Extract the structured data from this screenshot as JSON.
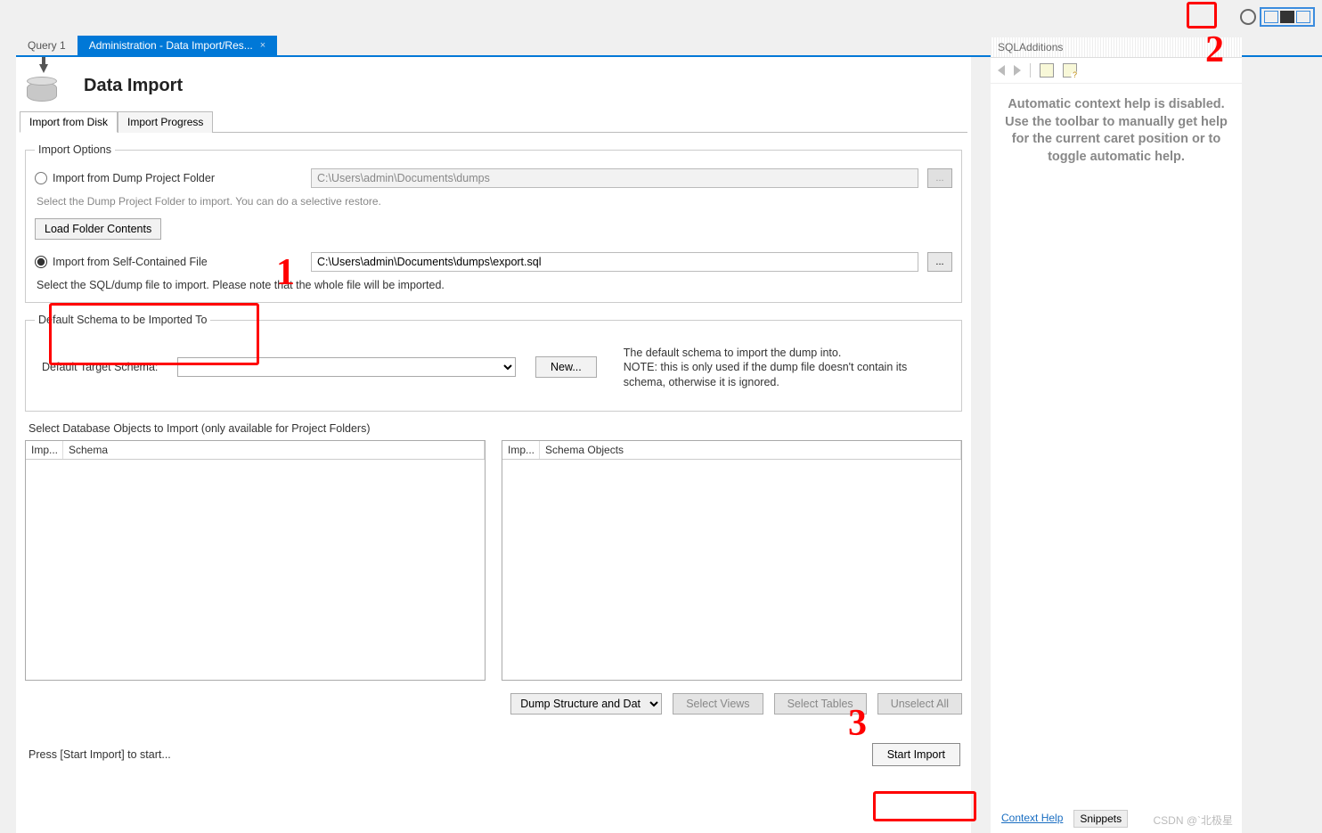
{
  "tabs": {
    "query": "Query 1",
    "admin": "Administration - Data Import/Res...",
    "close_glyph": "×"
  },
  "page": {
    "title": "Data Import"
  },
  "subtabs": {
    "disk": "Import from Disk",
    "progress": "Import Progress"
  },
  "import_options": {
    "legend": "Import Options",
    "from_folder_label": "Import from Dump Project Folder",
    "folder_path": "C:\\Users\\admin\\Documents\\dumps",
    "folder_hint": "Select the Dump Project Folder to import. You can do a selective restore.",
    "load_folder_btn": "Load Folder Contents",
    "from_file_label": "Import from Self-Contained File",
    "file_path": "C:\\Users\\admin\\Documents\\dumps\\export.sql",
    "file_hint": "Select the SQL/dump file to import. Please note that the whole file will be imported.",
    "browse_glyph": "..."
  },
  "default_schema": {
    "legend": "Default Schema to be Imported To",
    "label": "Default Target Schema:",
    "new_btn": "New...",
    "note": "The default schema to import the dump into.\nNOTE: this is only used if the dump file doesn't contain its schema, otherwise it is ignored."
  },
  "objects": {
    "title": "Select Database Objects to Import (only available for Project Folders)",
    "col_imp": "Imp...",
    "col_schema": "Schema",
    "col_schema_objects": "Schema Objects",
    "combo_value": "Dump Structure and Dat",
    "select_views": "Select Views",
    "select_tables": "Select Tables",
    "unselect_all": "Unselect All"
  },
  "footer": {
    "hint": "Press [Start Import] to start...",
    "start_btn": "Start Import"
  },
  "side": {
    "header": "SQLAdditions",
    "msg": "Automatic context help is disabled. Use the toolbar to manually get help for the current caret position or to toggle automatic help.",
    "tab_context": "Context Help",
    "tab_snippets": "Snippets"
  },
  "annotations": {
    "n1": "1",
    "n2": "2",
    "n3": "3"
  },
  "watermark": "CSDN @`北极星"
}
